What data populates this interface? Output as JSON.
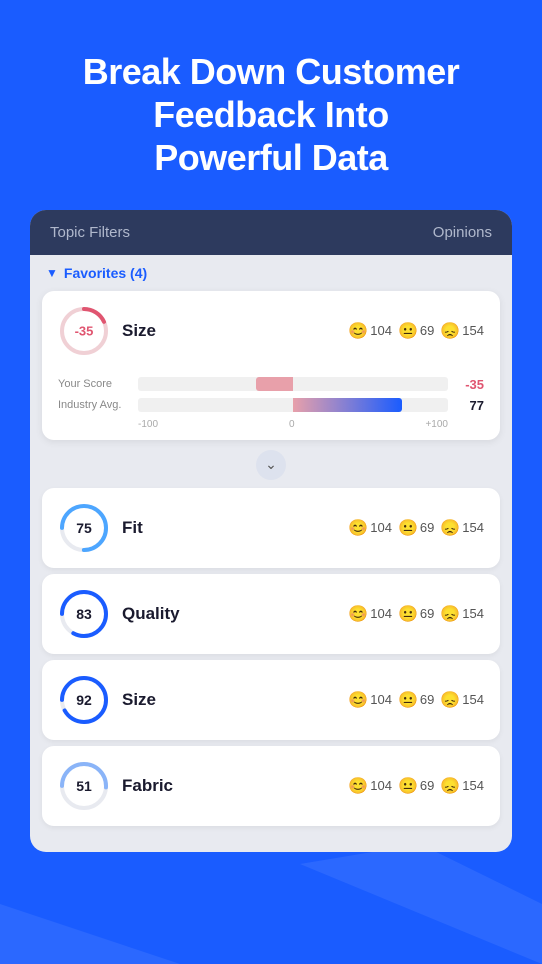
{
  "hero": {
    "title_line1": "Break Down Customer",
    "title_line2": "Feedback Into",
    "title_line3": "Powerful Data"
  },
  "card": {
    "header": {
      "topic_label": "Topic Filters",
      "opinions_label": "Opinions"
    },
    "favorites": {
      "label": "Favorites (4)",
      "chevron": "▼"
    },
    "expanded_item": {
      "score": "-35",
      "label": "Size",
      "happy_count": "104",
      "neutral_count": "69",
      "sad_count": "154",
      "your_score_label": "Your Score",
      "your_score_value": "-35",
      "industry_label": "Industry Avg.",
      "industry_value": "77",
      "axis_left": "-100",
      "axis_center": "0",
      "axis_right": "+100"
    },
    "items": [
      {
        "score": "75",
        "label": "Fit",
        "happy": "104",
        "neutral": "69",
        "sad": "154",
        "progress": 75,
        "color": "#4da6ff"
      },
      {
        "score": "83",
        "label": "Quality",
        "happy": "104",
        "neutral": "69",
        "sad": "154",
        "progress": 83,
        "color": "#1a5cff"
      },
      {
        "score": "92",
        "label": "Size",
        "happy": "104",
        "neutral": "69",
        "sad": "154",
        "progress": 92,
        "color": "#1a5cff"
      },
      {
        "score": "51",
        "label": "Fabric",
        "happy": "104",
        "neutral": "69",
        "sad": "154",
        "progress": 51,
        "color": "#8ab4f8"
      }
    ]
  },
  "icons": {
    "happy": "😊",
    "neutral": "😐",
    "sad": "😞",
    "chevron_down": "⌄"
  }
}
